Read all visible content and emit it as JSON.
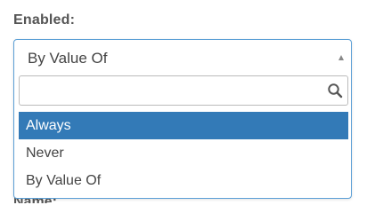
{
  "field": {
    "label": "Enabled:",
    "next_label_partial": "Name:"
  },
  "select": {
    "current_value": "By Value Of",
    "search_placeholder": "",
    "search_value": "",
    "options": [
      {
        "label": "Always",
        "highlighted": true
      },
      {
        "label": "Never",
        "highlighted": false
      },
      {
        "label": "By Value Of",
        "highlighted": false
      }
    ]
  },
  "colors": {
    "highlight": "#337ab7",
    "focus_border": "#5b9fd6",
    "label_text": "#555555"
  },
  "icons": {
    "caret": "caret-up-icon",
    "search": "search-icon"
  }
}
